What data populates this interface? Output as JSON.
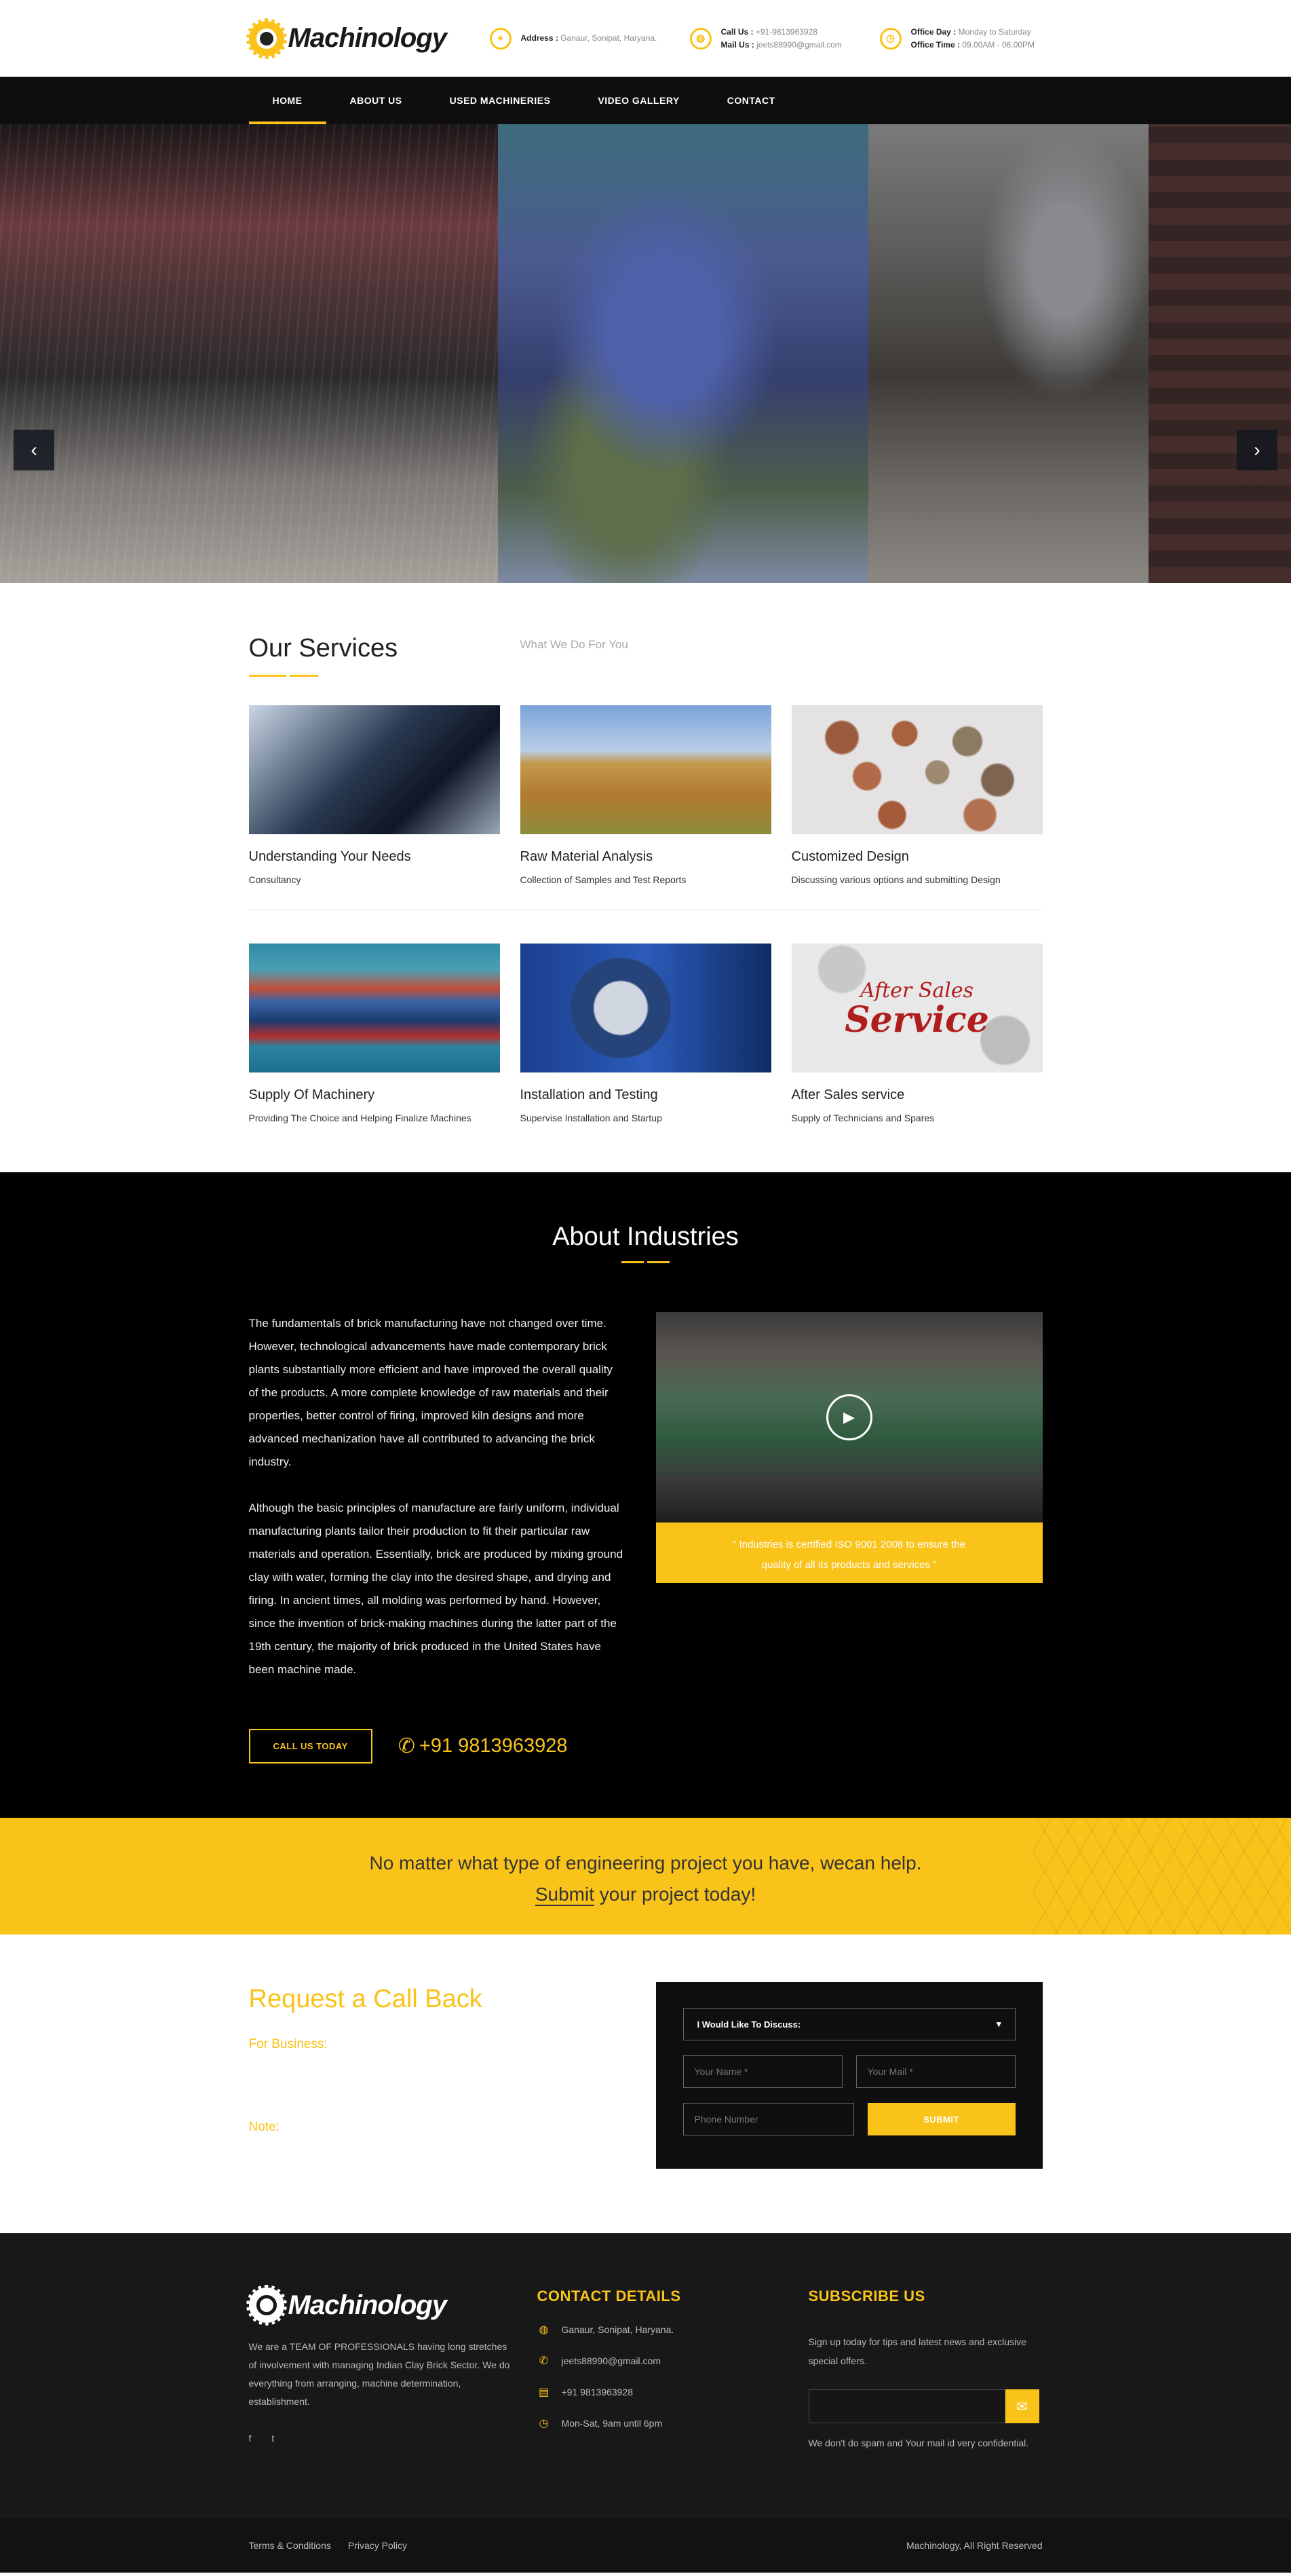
{
  "header": {
    "logo_text": "Machinology",
    "address_label": "Address :",
    "address_value": "Ganaur, Sonipat, Haryana.",
    "call_label": "Call Us :",
    "call_value": "+91-9813963928",
    "mail_label": "Mail Us :",
    "mail_value": "jeets88990@gmail.com",
    "office_day_label": "Office Day :",
    "office_day_value": "Monday to Saturday",
    "office_time_label": "Office Time :",
    "office_time_value": "09.00AM - 06.00PM"
  },
  "nav": {
    "items": [
      "HOME",
      "ABOUT US",
      "USED MACHINERIES",
      "VIDEO GALLERY",
      "CONTACT"
    ],
    "active": "HOME"
  },
  "slider": {
    "prev": "‹",
    "next": "›"
  },
  "services": {
    "title": "Our Services",
    "subtitle": "What We Do For You",
    "items": [
      {
        "title": "Understanding Your Needs",
        "desc": "Consultancy"
      },
      {
        "title": "Raw Material Analysis",
        "desc": "Collection of Samples and Test Reports"
      },
      {
        "title": "Customized Design",
        "desc": "Discussing various options and submitting Design"
      },
      {
        "title": "Supply Of Machinery",
        "desc": "Providing The Choice and Helping Finalize Machines"
      },
      {
        "title": "Installation and Testing",
        "desc": "Supervise Installation and Startup"
      },
      {
        "title": "After Sales service",
        "desc": "Supply of Technicians and Spares"
      }
    ],
    "aftersales_img_line1": "After Sales",
    "aftersales_img_line2": "Service"
  },
  "about": {
    "title": "About Industries",
    "para1": "The fundamentals of brick manufacturing have not changed over time. However, technological advancements have made contemporary brick plants substantially more efficient and have improved the overall quality of the products. A more complete knowledge of raw materials and their properties, better control of firing, improved kiln designs and more advanced mechanization have all contributed to advancing the brick industry.",
    "para2": "Although the basic principles of manufacture are fairly uniform, individual manufacturing plants tailor their production to fit their particular raw materials and operation. Essentially, brick are produced by mixing ground clay with water, forming the clay into the desired shape, and drying and firing. In ancient times, all molding was performed by hand. However, since the invention of brick-making machines during the latter part of the 19th century, the majority of brick produced in the United States have been machine made.",
    "video_caption": "\" Industries is certified ISO 9001 2008 to ensure the quality of all its products and services \"",
    "cta_button": "CALL US TODAY",
    "cta_phone": "+91 9813963928"
  },
  "band": {
    "line1": "No matter what type of engineering project you have, wecan help.",
    "submit_link": "Submit",
    "line2_rest": " your project today!"
  },
  "callback": {
    "title": "Request a Call Back",
    "business_label": "For Business:",
    "note_label": "Note:",
    "select_value": "I Would Like To Discuss:",
    "name_placeholder": "Your Name *",
    "mail_placeholder": "Your Mail *",
    "phone_placeholder": "Phone Number",
    "submit_label": "SUBMIT"
  },
  "footer": {
    "logo_text": "Machinology",
    "about_text": "We are a TEAM OF PROFESSIONALS having long stretches of involvement with managing Indian Clay Brick Sector. We do everything from arranging, machine determination, establishment.",
    "social": [
      "f",
      "t"
    ],
    "contact_title": "CONTACT DETAILS",
    "contact_items": [
      {
        "icon": "globe-icon",
        "text": "Ganaur, Sonipat, Haryana."
      },
      {
        "icon": "phone-icon",
        "text": "jeets88990@gmail.com"
      },
      {
        "icon": "fax-icon",
        "text": "+91 9813963928"
      },
      {
        "icon": "clock-icon",
        "text": "Mon-Sat, 9am until 6pm"
      }
    ],
    "subscribe_title": "SUBSCRIBE US",
    "subscribe_text": "Sign up today for tips and latest news and exclusive special offers.",
    "subscribe_note": "We don't do spam and Your mail id very confidential.",
    "terms": "Terms & Conditions",
    "privacy": "Privacy Policy",
    "copyright": "Machinology, All Right Reserved"
  },
  "colors": {
    "accent": "#f9c31a",
    "dark": "#0e0e0e"
  }
}
